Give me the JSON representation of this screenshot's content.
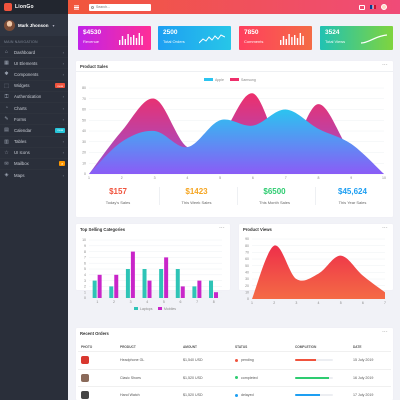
{
  "app": {
    "name": "LionGo"
  },
  "user": {
    "name": "Mark Jhonson"
  },
  "sidebar": {
    "header": "MAIN NAVIGATION",
    "items": [
      {
        "label": "Dashboard",
        "icon": "dashboard-icon",
        "glyph": "⌂"
      },
      {
        "label": "UI Elements",
        "icon": "grid-icon",
        "glyph": "▦"
      },
      {
        "label": "Components",
        "icon": "puzzle-icon",
        "glyph": "✱"
      },
      {
        "label": "Widgets",
        "icon": "widget-icon",
        "glyph": "⬚",
        "badge": "new",
        "badge_color": "#f0533d"
      },
      {
        "label": "Authentication",
        "icon": "lock-icon",
        "glyph": "⚿"
      },
      {
        "label": "Charts",
        "icon": "chart-icon",
        "glyph": "◔"
      },
      {
        "label": "Forms",
        "icon": "form-icon",
        "glyph": "✎"
      },
      {
        "label": "Calendar",
        "icon": "calendar-icon",
        "glyph": "▤",
        "badge": "new",
        "badge_color": "#26c6da"
      },
      {
        "label": "Tables",
        "icon": "table-icon",
        "glyph": "▥"
      },
      {
        "label": "UI Icons",
        "icon": "star-icon",
        "glyph": "☆"
      },
      {
        "label": "Mailbox",
        "icon": "mail-icon",
        "glyph": "✉",
        "badge": "8",
        "badge_color": "#ff9800"
      },
      {
        "label": "Maps",
        "icon": "map-icon",
        "glyph": "◈"
      }
    ]
  },
  "topbar": {
    "search_placeholder": "Search..."
  },
  "stats": [
    {
      "value": "$4530",
      "label": "Revenue",
      "color_from": "#c123e8",
      "color_to": "#ff2e97",
      "spark": "bars"
    },
    {
      "value": "2500",
      "label": "Total Orders",
      "color_from": "#1e9ff2",
      "color_to": "#27c6e8",
      "spark": "line"
    },
    {
      "value": "7850",
      "label": "Comments",
      "color_from": "#ff3f5e",
      "color_to": "#f46b45",
      "spark": "bars"
    },
    {
      "value": "3524",
      "label": "Total Views",
      "color_from": "#21c2b3",
      "color_to": "#7fd43e",
      "spark": "curve"
    }
  ],
  "product_sales": {
    "title": "Product Sales",
    "summaries": [
      {
        "value": "$157",
        "label": "Today's Sales",
        "color": "#f0533d"
      },
      {
        "value": "$1423",
        "label": "This Week Sales",
        "color": "#f5a623"
      },
      {
        "value": "$6500",
        "label": "This Month Sales",
        "color": "#2ecc71"
      },
      {
        "value": "$45,624",
        "label": "This Year Sales",
        "color": "#1e9ff2"
      }
    ]
  },
  "top_selling": {
    "title": "Top Selling Categories"
  },
  "product_views": {
    "title": "Product Views"
  },
  "recent_orders": {
    "title": "Recent Orders",
    "columns": [
      "PHOTO",
      "PRODUCT",
      "AMOUNT",
      "STATUS",
      "COMPLETION",
      "DATE"
    ],
    "rows": [
      {
        "product": "Headphone GL",
        "amount": "$1,540 USD",
        "status": "pending",
        "status_color": "#f0533d",
        "completion": 0.55,
        "bar_color": "#f0533d",
        "date": "15 July 2019",
        "thumb_color": "#d9382f"
      },
      {
        "product": "Clasic Shoes",
        "amount": "$1,520 USD",
        "status": "completed",
        "status_color": "#2ecc71",
        "completion": 0.9,
        "bar_color": "#2ecc71",
        "date": "16 July 2019",
        "thumb_color": "#8a6a5a"
      },
      {
        "product": "Hand Watch",
        "amount": "$1,520 USD",
        "status": "delayed",
        "status_color": "#1e9ff2",
        "completion": 0.65,
        "bar_color": "#1e9ff2",
        "date": "17 July 2019",
        "thumb_color": "#444"
      }
    ]
  },
  "chart_data": [
    {
      "type": "area",
      "title": "Product Sales",
      "legend": [
        "Apple",
        "Samsung"
      ],
      "legend_placement": "top-center",
      "x": [
        1,
        2,
        3,
        4,
        5,
        6,
        7,
        8,
        9,
        10
      ],
      "ylim": [
        0,
        80
      ],
      "yticks": [
        0,
        10,
        20,
        30,
        40,
        50,
        60,
        70,
        80
      ],
      "series": [
        {
          "name": "Apple",
          "color": "#2bc4f0",
          "values": [
            0,
            30,
            40,
            25,
            50,
            45,
            60,
            42,
            28,
            0
          ]
        },
        {
          "name": "Samsung",
          "color": "#ee2f6b",
          "values": [
            0,
            40,
            70,
            25,
            35,
            75,
            20,
            65,
            20,
            0
          ]
        }
      ]
    },
    {
      "type": "bar",
      "title": "Top Selling Categories",
      "legend": [
        "Laptops",
        "Mobiles"
      ],
      "legend_placement": "bottom-center",
      "categories": [
        "1",
        "2",
        "3",
        "4",
        "5",
        "6",
        "7",
        "8"
      ],
      "ylim": [
        0,
        10
      ],
      "yticks": [
        0,
        1,
        2,
        3,
        4,
        5,
        6,
        7,
        8,
        9,
        10
      ],
      "series": [
        {
          "name": "Laptops",
          "color": "#2ec4b6",
          "values": [
            3,
            2,
            5,
            5,
            5,
            5,
            2,
            3
          ]
        },
        {
          "name": "Mobiles",
          "color": "#c925c9",
          "values": [
            4,
            4,
            8,
            3,
            7,
            2,
            3,
            1
          ]
        }
      ]
    },
    {
      "type": "area",
      "title": "Product Views",
      "x": [
        1,
        2,
        3,
        4,
        5,
        6,
        7
      ],
      "ylim": [
        0,
        90
      ],
      "yticks": [
        0,
        10,
        20,
        30,
        40,
        50,
        60,
        70,
        80,
        90
      ],
      "series": [
        {
          "name": "",
          "color": "#ee2f4a",
          "values": [
            0,
            80,
            30,
            38,
            65,
            35,
            10
          ]
        }
      ]
    }
  ]
}
